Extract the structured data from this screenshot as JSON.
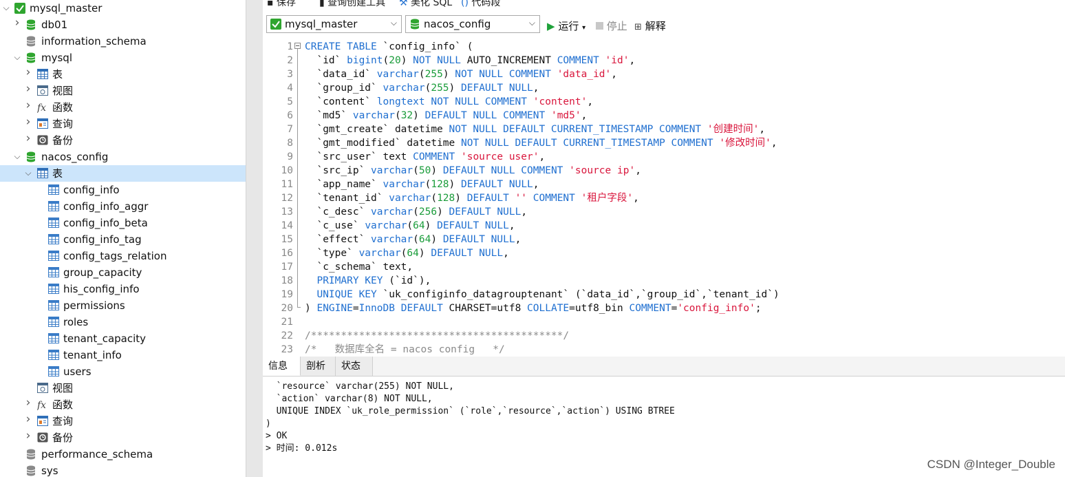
{
  "sidebar": {
    "items": [
      {
        "label": "mysql_master",
        "icon": "connection-icon"
      },
      {
        "label": "db01",
        "icon": "database-icon"
      },
      {
        "label": "information_schema",
        "icon": "database-gray-icon"
      },
      {
        "label": "mysql",
        "icon": "database-icon"
      },
      {
        "label": "表",
        "icon": "table-folder-icon"
      },
      {
        "label": "视图",
        "icon": "view-icon"
      },
      {
        "label": "函数",
        "icon": "function-icon"
      },
      {
        "label": "查询",
        "icon": "query-icon"
      },
      {
        "label": "备份",
        "icon": "backup-icon"
      },
      {
        "label": "nacos_config",
        "icon": "database-icon"
      },
      {
        "label": "表",
        "icon": "table-folder-icon"
      },
      {
        "label": "config_info",
        "icon": "table-icon"
      },
      {
        "label": "config_info_aggr",
        "icon": "table-icon"
      },
      {
        "label": "config_info_beta",
        "icon": "table-icon"
      },
      {
        "label": "config_info_tag",
        "icon": "table-icon"
      },
      {
        "label": "config_tags_relation",
        "icon": "table-icon"
      },
      {
        "label": "group_capacity",
        "icon": "table-icon"
      },
      {
        "label": "his_config_info",
        "icon": "table-icon"
      },
      {
        "label": "permissions",
        "icon": "table-icon"
      },
      {
        "label": "roles",
        "icon": "table-icon"
      },
      {
        "label": "tenant_capacity",
        "icon": "table-icon"
      },
      {
        "label": "tenant_info",
        "icon": "table-icon"
      },
      {
        "label": "users",
        "icon": "table-icon"
      },
      {
        "label": "视图",
        "icon": "view-icon"
      },
      {
        "label": "函数",
        "icon": "function-icon"
      },
      {
        "label": "查询",
        "icon": "query-icon"
      },
      {
        "label": "备份",
        "icon": "backup-icon"
      },
      {
        "label": "performance_schema",
        "icon": "database-gray-icon"
      },
      {
        "label": "sys",
        "icon": "database-gray-icon"
      }
    ]
  },
  "toolbar": {
    "save_label": "保存",
    "query_builder_label": "查询创建工具",
    "beautify_label": "美化 SQL",
    "snippet_label": "代码段",
    "connection_value": "mysql_master",
    "database_value": "nacos_config",
    "run_label": "运行",
    "stop_label": "停止",
    "explain_label": "解释"
  },
  "editor": {
    "line_numbers": [
      "1",
      "2",
      "3",
      "4",
      "5",
      "6",
      "7",
      "8",
      "9",
      "10",
      "11",
      "12",
      "13",
      "14",
      "15",
      "16",
      "17",
      "18",
      "19",
      "20",
      "21",
      "22",
      "23"
    ]
  },
  "bottom_tabs": {
    "info": "信息",
    "profile": "剖析",
    "status": "状态"
  },
  "output": {
    "lines": [
      "  `resource` varchar(255) NOT NULL,",
      "  `action` varchar(8) NOT NULL,",
      "  UNIQUE INDEX `uk_role_permission` (`role`,`resource`,`action`) USING BTREE",
      ")",
      "> OK",
      "> 时间: 0.012s"
    ]
  },
  "watermark": "CSDN @Integer_Double",
  "colors": {
    "keyword": "#1f6fd0",
    "number": "#1a9c3a",
    "string": "#d9163c",
    "selection": "#cce5fb"
  }
}
